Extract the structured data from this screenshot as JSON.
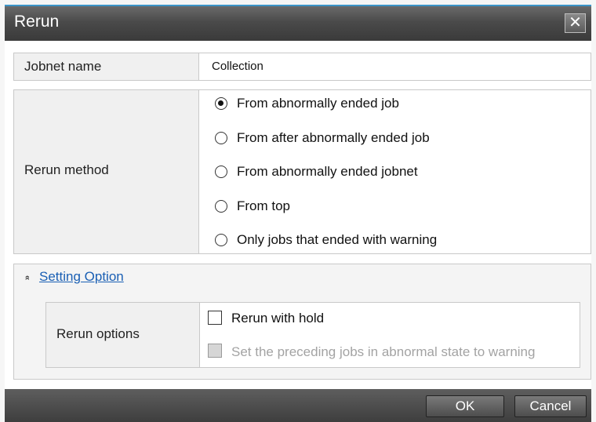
{
  "dialog": {
    "title": "Rerun",
    "close_glyph": "✕"
  },
  "jobnet": {
    "label": "Jobnet name",
    "value": "Collection"
  },
  "rerun_method": {
    "label": "Rerun method",
    "options": [
      {
        "label": "From abnormally ended job",
        "selected": true
      },
      {
        "label": "From after abnormally ended job",
        "selected": false
      },
      {
        "label": "From abnormally ended jobnet",
        "selected": false
      },
      {
        "label": "From top",
        "selected": false
      },
      {
        "label": "Only jobs that ended with warning",
        "selected": false
      }
    ]
  },
  "setting_option": {
    "link_label": "Setting Option",
    "collapse_glyph": "»",
    "rerun_options": {
      "label": "Rerun options",
      "checkboxes": [
        {
          "label": "Rerun with hold",
          "checked": false,
          "enabled": true
        },
        {
          "label": "Set the preceding jobs in abnormal state to warning",
          "checked": false,
          "enabled": false
        }
      ]
    }
  },
  "footer": {
    "ok_label": "OK",
    "cancel_label": "Cancel"
  }
}
